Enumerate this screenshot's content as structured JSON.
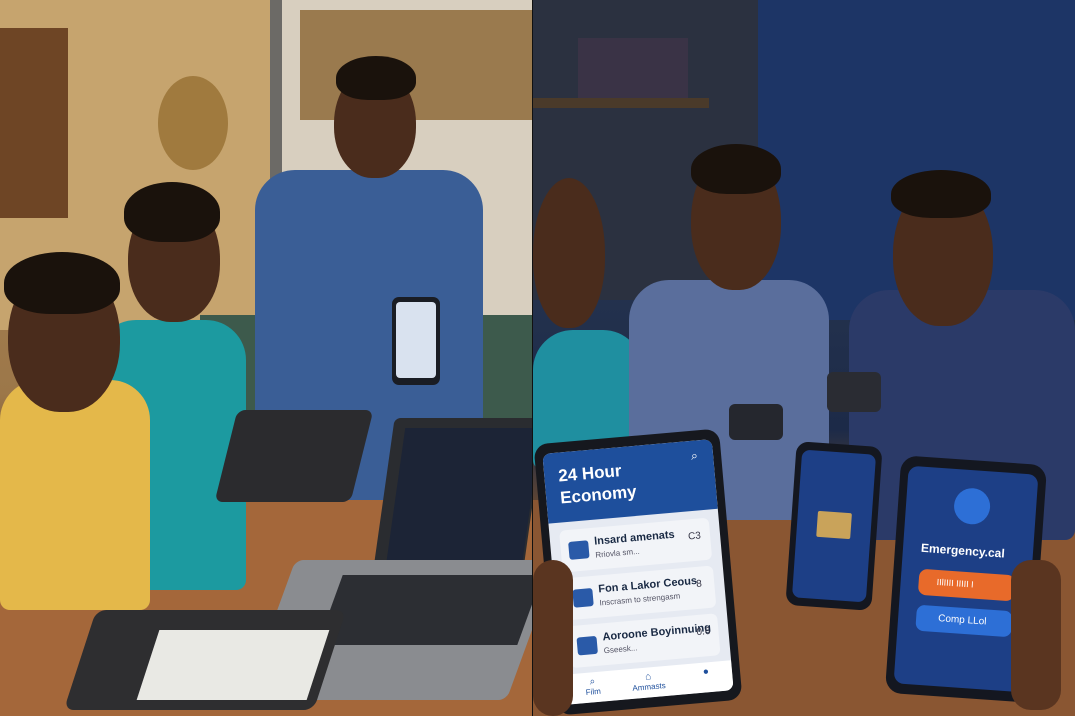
{
  "scene": {
    "left_panel": {
      "description_hidden": true,
      "phone_screen_color": "#d9e2ef",
      "laptop_screen_color": "#1c2436"
    },
    "right_panel": {
      "tablet_app": {
        "title_line1": "24 Hour",
        "title_line2": "Economy",
        "items": [
          {
            "title": "lnsard amenats",
            "subtitle": "Rriovla sm...",
            "value": "C3"
          },
          {
            "title": "Fon a Lakor Ceous",
            "subtitle": "Inscrasm to strengasm",
            "value": "8"
          },
          {
            "title": "Aoroone Boyinnuing",
            "subtitle": "Gseesk...",
            "value": "0.6"
          }
        ],
        "nav": [
          {
            "label": "Film",
            "icon": "search-icon"
          },
          {
            "label": "Ammasts",
            "icon": "home-icon"
          },
          {
            "label": "",
            "icon": "user-icon"
          }
        ],
        "accent": "#1e4f9c"
      },
      "emergency_app": {
        "title": "Emergency.cal",
        "primary_button": "IIlIIII IIIII I",
        "secondary_button": "Comp LLol",
        "primary_color": "#e86a2a",
        "secondary_color": "#2d6fd6"
      }
    }
  }
}
